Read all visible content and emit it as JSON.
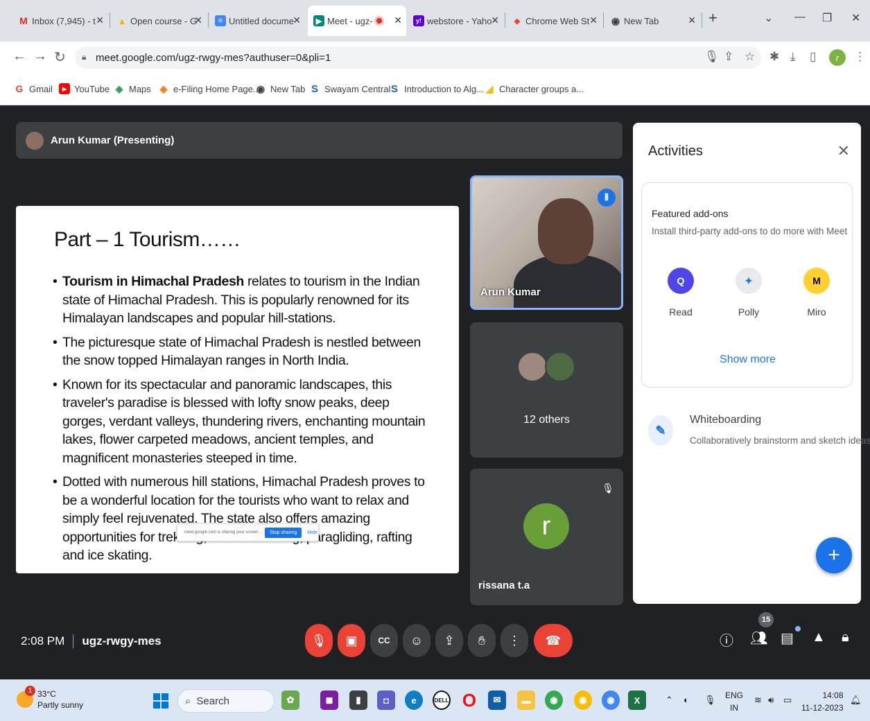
{
  "browser": {
    "tabs": [
      {
        "title": "Inbox (7,945) - t",
        "favicon": "gmail-icon",
        "color": "#d93025",
        "glyph": "M"
      },
      {
        "title": "Open course - G",
        "favicon": "drive-icon",
        "color": "#f4b400",
        "glyph": "▲"
      },
      {
        "title": "Untitled docume",
        "favicon": "docs-icon",
        "color": "#4285f4",
        "glyph": "≡"
      },
      {
        "title": "Meet - ugz-",
        "favicon": "meet-icon",
        "color": "#00897b",
        "glyph": "▶",
        "active": true
      },
      {
        "title": "webstore - Yaho",
        "favicon": "yahoo-icon",
        "color": "#6001d2",
        "glyph": "y!"
      },
      {
        "title": "Chrome Web St",
        "favicon": "webstore-icon",
        "color": "#ea4335",
        "glyph": "◆"
      },
      {
        "title": "New Tab",
        "favicon": "newtab-icon",
        "color": "#5f6368",
        "glyph": "◉"
      }
    ],
    "new_tab": "+",
    "url": "meet.google.com/ugz-rwgy-mes?authuser=0&pli=1",
    "profile_initial": "r",
    "bookmarks": [
      {
        "label": "Gmail",
        "glyph": "G",
        "color": "#ea4335"
      },
      {
        "label": "YouTube",
        "glyph": "▶",
        "color": "#ff0000"
      },
      {
        "label": "Maps",
        "glyph": "◆",
        "color": "#34a853"
      },
      {
        "label": "e-Filing Home Page...",
        "glyph": "◈",
        "color": "#f57c00"
      },
      {
        "label": "New Tab",
        "glyph": "◉",
        "color": "#3c4043"
      },
      {
        "label": "Swayam Central",
        "glyph": "S",
        "color": "#1565c0"
      },
      {
        "label": "Introduction to Alg...",
        "glyph": "S",
        "color": "#1565c0"
      },
      {
        "label": "Character groups a...",
        "glyph": "◢",
        "color": "#fbbc04"
      }
    ]
  },
  "meet": {
    "presenter": "Arun Kumar (Presenting)",
    "slide": {
      "title": "Part – 1 Tourism……",
      "bullets": [
        {
          "bold": "Tourism in Himachal Pradesh",
          "text": " relates to tourism in the Indian state of Himachal Pradesh. This is popularly renowned for its Himalayan landscapes and popular hill-stations."
        },
        {
          "bold": "",
          "text": "The picturesque state of Himachal Pradesh is nestled between the snow topped Himalayan ranges in North India."
        },
        {
          "bold": "",
          "text": "Known for its spectacular and panoramic landscapes, this traveler's paradise is blessed with lofty snow peaks, deep gorges, verdant valleys, thundering rivers, enchanting mountain lakes, flower carpeted meadows, ancient temples, and magnificent monasteries steeped in time."
        },
        {
          "bold": "",
          "text": "Dotted with numerous hill stations, Himachal Pradesh proves to be a wonderful location for the tourists who want to relax and simply feel rejuvenated. The state also offers amazing opportunities for trekking, mountaineering, paragliding, rafting and ice skating."
        }
      ]
    },
    "share_notice": {
      "text": "meet.google.com is sharing your screen.",
      "stop": "Stop sharing",
      "hide": "Hide"
    },
    "tiles": {
      "video_name": "Arun Kumar",
      "others": "12 others",
      "participant_name": "rissana t.a",
      "participant_initial": "r"
    },
    "time": "2:08 PM",
    "meeting_code": "ugz-rwgy-mes",
    "participant_count": "15"
  },
  "activities": {
    "title": "Activities",
    "featured_title": "Featured add-ons",
    "featured_subtitle": "Install third-party add-ons to do more with Meet",
    "addons": [
      {
        "name": "Read",
        "glyph": "Q",
        "color": "#4f46e5"
      },
      {
        "name": "Polly",
        "glyph": "✦",
        "color": "#1a73e8"
      },
      {
        "name": "Miro",
        "glyph": "M",
        "color": "#ffd02f"
      }
    ],
    "show_more": "Show more",
    "whiteboard_title": "Whiteboarding",
    "whiteboard_subtitle": "Collaboratively brainstorm and sketch ideas"
  },
  "taskbar": {
    "temperature": "33°C",
    "condition": "Partly sunny",
    "weather_badge": "1",
    "search": "Search",
    "lang1": "ENG",
    "lang2": "IN",
    "time": "14:08",
    "date": "11-12-2023"
  }
}
